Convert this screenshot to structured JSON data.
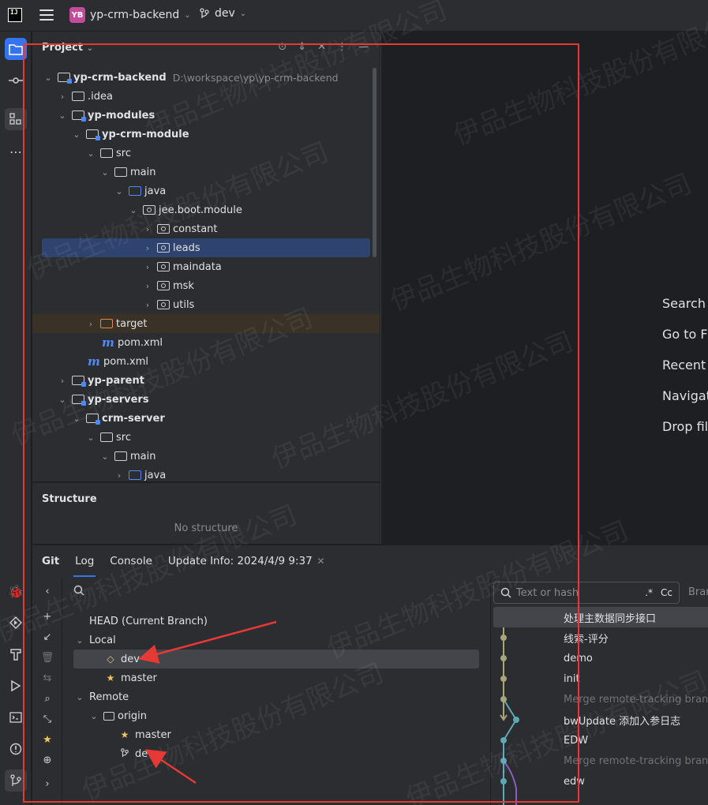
{
  "titlebar": {
    "logo_text": "IJ",
    "project_badge": "YB",
    "project_name": "yp-crm-backend",
    "branch_name": "dev"
  },
  "project_panel": {
    "title": "Project",
    "tree": [
      {
        "label": "yp-crm-backend",
        "path": "D:\\workspace\\yp\\yp-crm-backend",
        "bold": true
      },
      {
        "label": ".idea"
      },
      {
        "label": "yp-modules",
        "bold": true
      },
      {
        "label": "yp-crm-module",
        "bold": true
      },
      {
        "label": "src"
      },
      {
        "label": "main"
      },
      {
        "label": "java"
      },
      {
        "label": "jee.boot.module"
      },
      {
        "label": "constant"
      },
      {
        "label": "leads"
      },
      {
        "label": "maindata"
      },
      {
        "label": "msk"
      },
      {
        "label": "utils"
      },
      {
        "label": "target"
      },
      {
        "label": "pom.xml"
      },
      {
        "label": "pom.xml"
      },
      {
        "label": "yp-parent",
        "bold": true
      },
      {
        "label": "yp-servers",
        "bold": true
      },
      {
        "label": "crm-server",
        "bold": true
      },
      {
        "label": "src"
      },
      {
        "label": "main"
      },
      {
        "label": "java"
      }
    ]
  },
  "structure_panel": {
    "title": "Structure",
    "empty_text": "No structure"
  },
  "editor_hints": [
    "Search E",
    "Go to Fi",
    "Recent",
    "Navigat",
    "Drop fil"
  ],
  "git_panel": {
    "label": "Git",
    "tabs": [
      "Log",
      "Console",
      "Update Info: 2024/4/9 9:37"
    ],
    "branches": {
      "head": "HEAD (Current Branch)",
      "local": "Local",
      "local_items": [
        "dev",
        "master"
      ],
      "remote": "Remote",
      "origin": "origin",
      "remote_items": [
        "master",
        "dev"
      ]
    },
    "log": {
      "search_placeholder": "Text or hash",
      "regex_opt": ".*",
      "case_opt": "Cc",
      "branch_filter": "Bran",
      "commits": [
        {
          "message": "处理主数据同步接口",
          "dim": false
        },
        {
          "message": "线索-评分",
          "dim": false
        },
        {
          "message": "demo",
          "dim": false
        },
        {
          "message": "init",
          "dim": false
        },
        {
          "message": "Merge remote-tracking branc",
          "dim": true
        },
        {
          "message": "bwUpdate 添加入参日志",
          "dim": false
        },
        {
          "message": "EDW",
          "dim": false
        },
        {
          "message": "Merge remote-tracking branc",
          "dim": true
        },
        {
          "message": "edw",
          "dim": false
        }
      ]
    }
  },
  "watermark": "伊品生物科技股份有限公司",
  "colors": {
    "accent": "#3574f0",
    "annotation": "#e53935",
    "graph_main": "#a8a57a",
    "graph_branch": "#5fa8b8",
    "graph_purple": "#8a5fb8"
  }
}
